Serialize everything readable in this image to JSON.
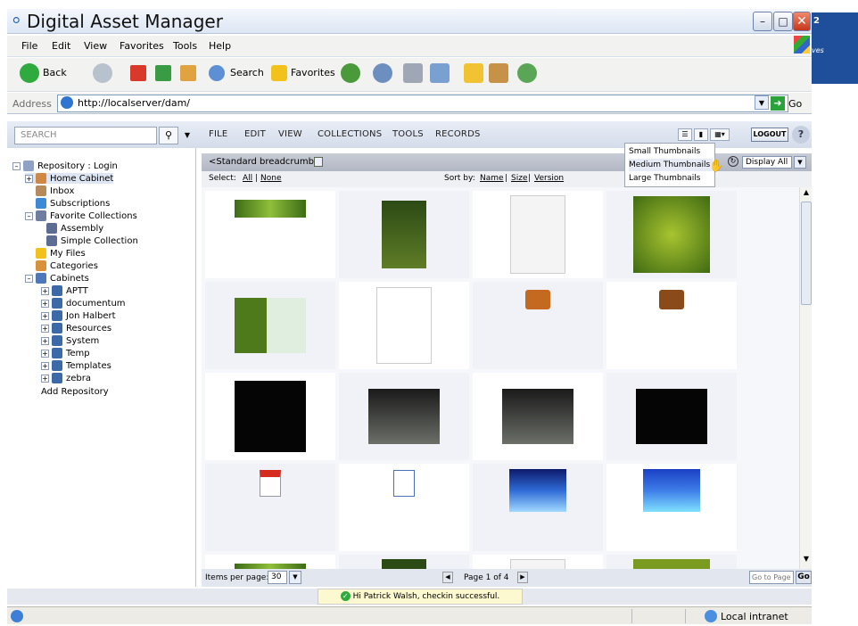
{
  "window": {
    "title": "Digital Asset Manager"
  },
  "side_banner": {
    "text": "2",
    "tagline": "ves"
  },
  "menubar": {
    "items": [
      "File",
      "Edit",
      "View",
      "Favorites",
      "Tools",
      "Help"
    ]
  },
  "toolbar": {
    "back": "Back",
    "search": "Search",
    "favorites": "Favorites"
  },
  "address": {
    "label": "Address",
    "url": "http://localserver/dam/",
    "go": "Go"
  },
  "dam": {
    "search_placeholder": "SEARCH",
    "menu": [
      "FILE",
      "EDIT",
      "VIEW",
      "COLLECTIONS",
      "TOOLS",
      "RECORDS"
    ],
    "logout": "LOGOUT",
    "help": "?"
  },
  "tree": [
    {
      "label": "Repository : Login"
    },
    {
      "label": "Home Cabinet"
    },
    {
      "label": "Inbox"
    },
    {
      "label": "Subscriptions"
    },
    {
      "label": "Favorite Collections"
    },
    {
      "label": "Assembly"
    },
    {
      "label": "Simple Collection"
    },
    {
      "label": "My Files"
    },
    {
      "label": "Categories"
    },
    {
      "label": "Cabinets"
    },
    {
      "label": "APTT"
    },
    {
      "label": "documentum"
    },
    {
      "label": "Jon Halbert"
    },
    {
      "label": "Resources"
    },
    {
      "label": "System"
    },
    {
      "label": "Temp"
    },
    {
      "label": "Templates"
    },
    {
      "label": "zebra"
    },
    {
      "label": "Add Repository"
    }
  ],
  "breadcrumb": {
    "text": "<Standard breadcrumb>",
    "display": "Display All"
  },
  "select": {
    "label": "Select:",
    "all": "All",
    "none": "None"
  },
  "sort": {
    "label": "Sort by:",
    "name": "Name",
    "size": "Size",
    "version": "Version"
  },
  "thumb_menu": [
    "Small Thumbnails",
    "Medium Thumbnails",
    "Large Thumbnails"
  ],
  "paging": {
    "items_label": "Items per page:",
    "items_value": "30",
    "page_text": "Page 1 of 4",
    "goto": "Go to Page",
    "go": "Go"
  },
  "status": {
    "message": "Hi Patrick Walsh, checkin successful.",
    "zone": "Local intranet"
  },
  "colors": {
    "accent": "#1f4e9a",
    "header_bg": "#d4dcea",
    "crumb_bg": "#b2b8c4"
  }
}
